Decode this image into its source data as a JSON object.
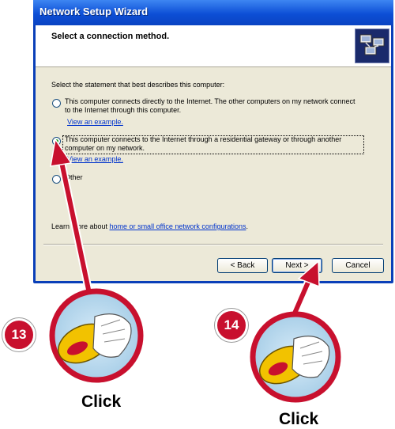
{
  "window": {
    "title": "Network Setup Wizard",
    "header_title": "Select a connection method."
  },
  "content": {
    "prompt": "Select the statement that best describes this computer:",
    "options": [
      {
        "line1": "This computer connects directly to the Internet. The other computers on my network connect",
        "line2": "to the Internet through this computer.",
        "link": "View an example.",
        "checked": false
      },
      {
        "line1": "This computer connects to the Internet through a residential gateway or through another",
        "line2": "computer on my network.",
        "link": "View an example.",
        "checked": true
      },
      {
        "line1": "Other",
        "checked": false
      }
    ],
    "learn_prefix": "Learn more about ",
    "learn_link": "home or small office network configurations",
    "learn_suffix": "."
  },
  "buttons": {
    "back": "< Back",
    "next": "Next >",
    "cancel": "Cancel"
  },
  "callouts": [
    {
      "step": "13",
      "label": "Click"
    },
    {
      "step": "14",
      "label": "Click"
    }
  ],
  "colors": {
    "arrow": "#c8102e",
    "title_bar": "#0d4fd6",
    "dialog_bg": "#ece9d8"
  },
  "icons": {
    "wizard": "network-computers-icon",
    "mouse": "mouse-click-hand-icon"
  }
}
